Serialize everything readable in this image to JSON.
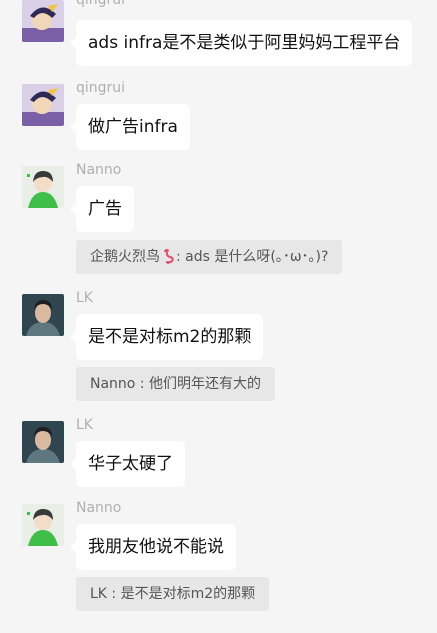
{
  "messages": [
    {
      "sender": "qingrui",
      "text": "ads infra是不是类似于阿里妈妈工程平台"
    },
    {
      "sender": "qingrui",
      "text": "做广告infra"
    },
    {
      "sender": "Nanno",
      "text": "广告",
      "quote": {
        "author": "企鹅火烈鸟",
        "emoji_icon": "flamingo-icon",
        "text": ": ads 是什么呀(｡･ω･｡)?"
      }
    },
    {
      "sender": "LK",
      "text": "是不是对标m2的那颗",
      "quote": {
        "text": "Nanno : 他们明年还有大的"
      }
    },
    {
      "sender": "LK",
      "text": "华子太硬了"
    },
    {
      "sender": "Nanno",
      "text": "我朋友他说不能说",
      "quote": {
        "text": "LK : 是不是对标m2的那颗"
      }
    }
  ]
}
